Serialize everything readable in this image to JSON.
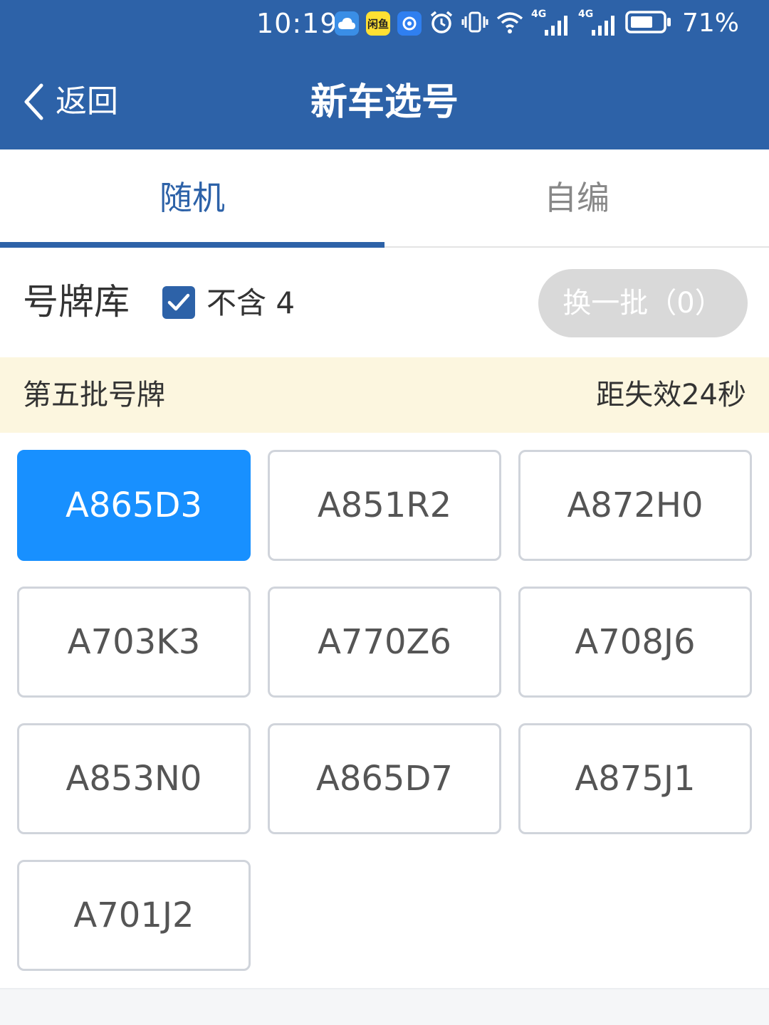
{
  "status_bar": {
    "time": "10:19",
    "app_badge_text": "闲鱼",
    "network_label_1": "4G",
    "network_label_2": "4G",
    "battery_percent": "71%"
  },
  "nav": {
    "back_label": "返回",
    "title": "新车选号"
  },
  "tabs": [
    {
      "label": "随机",
      "active": true
    },
    {
      "label": "自编",
      "active": false
    }
  ],
  "pool": {
    "label": "号牌库",
    "exclude_four_label": "不含 4",
    "exclude_four_checked": true,
    "refresh_label": "换一批（0）"
  },
  "batch": {
    "title": "第五批号牌",
    "expiry": "距失效24秒"
  },
  "plates": [
    {
      "number": "A865D3",
      "selected": true
    },
    {
      "number": "A851R2",
      "selected": false
    },
    {
      "number": "A872H0",
      "selected": false
    },
    {
      "number": "A703K3",
      "selected": false
    },
    {
      "number": "A770Z6",
      "selected": false
    },
    {
      "number": "A708J6",
      "selected": false
    },
    {
      "number": "A853N0",
      "selected": false
    },
    {
      "number": "A865D7",
      "selected": false
    },
    {
      "number": "A875J1",
      "selected": false
    },
    {
      "number": "A701J2",
      "selected": false
    }
  ],
  "colors": {
    "brand_blue": "#2d62a8",
    "selected_plate": "#1890ff",
    "batch_bar_bg": "#fcf6df",
    "disabled_button": "#d9d9d9"
  }
}
